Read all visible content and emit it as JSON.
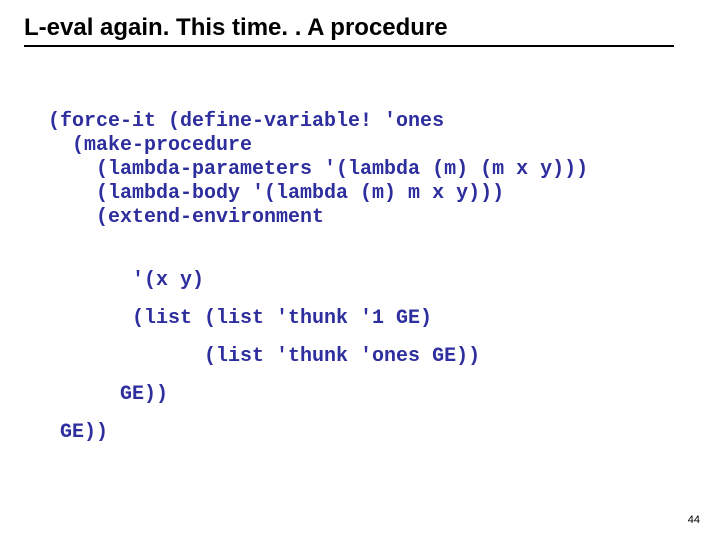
{
  "title": "L-eval again. This time. . A procedure",
  "code_block1": "(force-it (define-variable! 'ones\n  (make-procedure\n    (lambda-parameters '(lambda (m) (m x y)))\n    (lambda-body '(lambda (m) m x y)))\n    (extend-environment",
  "code_block2": "       '(x y)\n       (list (list 'thunk '1 GE)\n             (list 'thunk 'ones GE))\n      GE))\n GE))",
  "page_number": "44"
}
